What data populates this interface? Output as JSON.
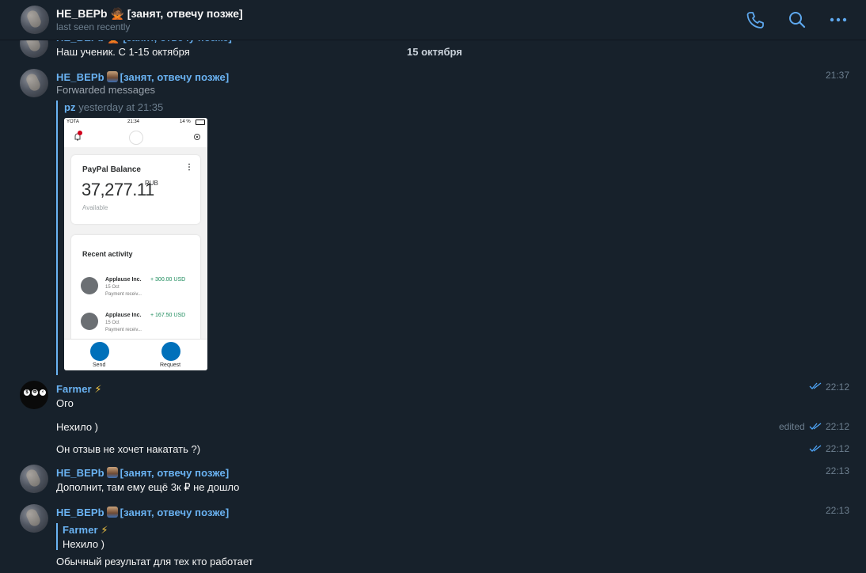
{
  "header": {
    "title": "HE_BEPb 🙅🏾 [занят, отвечу позже]",
    "status": "last seen recently"
  },
  "messages": {
    "m0": {
      "sender": "HE_BEPb 🙅🏾 [занят, отвечу позже]",
      "text": "Наш ученик. С 1-15 октября",
      "date_badge": "15 октября"
    },
    "m1": {
      "sender": "HE_BEPb",
      "sender_tag": "[занят, отвечу позже]",
      "time": "21:37",
      "fwd_label": "Forwarded messages",
      "fwd_from": "pz",
      "fwd_time": "yesterday at 21:35"
    },
    "m2": {
      "sender": "Farmer",
      "time": "22:12",
      "text": "Ого"
    },
    "m3": {
      "text": "Нехило )",
      "edited": "edited",
      "time": "22:12"
    },
    "m4": {
      "text": "Он отзыв не хочет накатать ?)",
      "time": "22:12"
    },
    "m5": {
      "sender": "HE_BEPb",
      "sender_tag": "[занят, отвечу позже]",
      "time": "22:13",
      "text": "Дополнит, там ему ещё 3к ₽ не дошло"
    },
    "m6": {
      "sender": "HE_BEPb",
      "sender_tag": "[занят, отвечу позже]",
      "time": "22:13",
      "reply_name": "Farmer",
      "reply_text": "Нехило )",
      "text": "Обычный результат для тех кто работает"
    }
  },
  "phone": {
    "status_left": "YOTA",
    "status_time": "21:34",
    "status_right": "14 %",
    "balance_title": "PayPal Balance",
    "balance_amount": "37,277.11",
    "balance_currency": "RUB",
    "balance_note": "Available",
    "recent_title": "Recent activity",
    "activity": [
      {
        "name": "Applause Inc.",
        "date": "15 Oct",
        "desc": "Payment receiv...",
        "amount": "+ 300.00 USD"
      },
      {
        "name": "Applause Inc.",
        "date": "15 Oct",
        "desc": "Payment receiv...",
        "amount": "+ 167.50 USD"
      }
    ],
    "send_label": "Send",
    "request_label": "Request"
  },
  "icons": {
    "call": "phone-icon",
    "search": "search-icon",
    "more": "more-icon",
    "read": "double-check-icon"
  },
  "colors": {
    "background": "#17212b",
    "accent": "#6ab3f3",
    "time": "#6d7f8f",
    "check": "#4ea4f6",
    "paypal": "#0070ba"
  }
}
